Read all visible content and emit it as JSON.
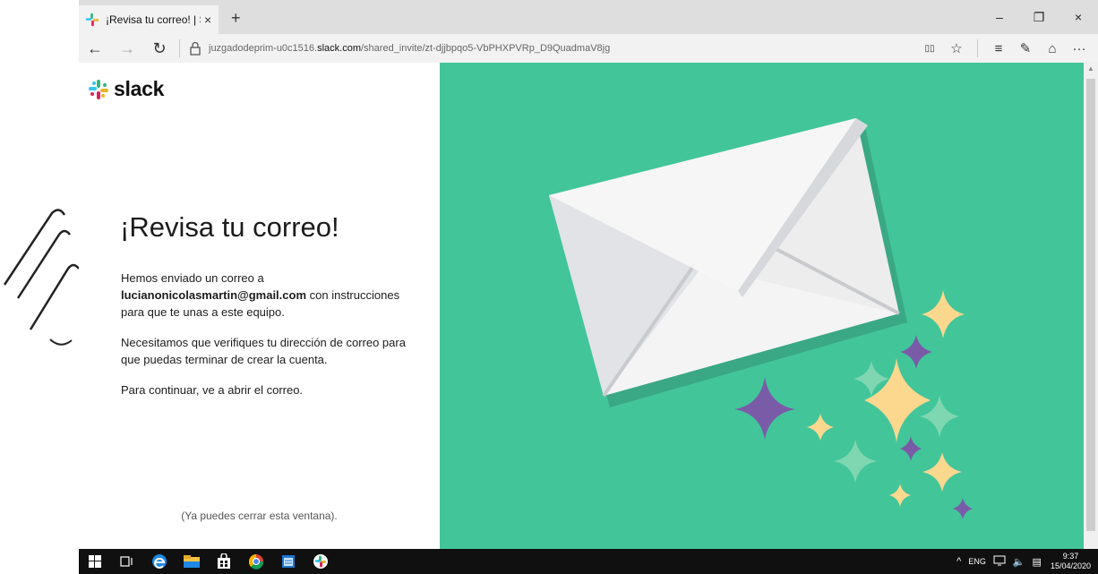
{
  "browser": {
    "tab_title": "¡Revisa tu correo! | Slack",
    "tab_close": "×",
    "new_tab": "+",
    "minimize": "–",
    "restore": "❐",
    "close": "×",
    "url_prefix": "juzgadodeprim-u0c1516.",
    "url_domain": "slack.com",
    "url_path": "/shared_invite/zt-djjbpqo5-VbPHXPVRp_D9QuadmaV8jg",
    "back": "←",
    "forward": "→",
    "refresh": "↻",
    "reading_view": "▯▯",
    "favorite": "☆",
    "hub": "≡",
    "notes": "✎",
    "share": "⌂",
    "more": "···"
  },
  "page": {
    "logo_text": "slack",
    "heading": "¡Revisa tu correo!",
    "p1_start": "Hemos enviado un correo a",
    "email": "lucianonicolasmartin@gmail.com",
    "p1_end": " con instrucciones para que te unas a este equipo.",
    "p2": "Necesitamos que verifiques tu dirección de correo para que puedas terminar de crear la cuenta.",
    "p3": "Para continuar, ve a abrir el correo.",
    "close_note": "(Ya puedes cerrar esta ventana)."
  },
  "taskbar": {
    "time": "9:37",
    "date": "15/04/2020",
    "tray_arrow": "^",
    "ime": "ENG",
    "volume": "🔈",
    "notification": "▤"
  },
  "colors": {
    "panel_green": "#43c59a",
    "sparkle_yellow": "#fcd88f",
    "sparkle_purple": "#7a5ba8",
    "sparkle_mint": "#7fd7b2"
  }
}
